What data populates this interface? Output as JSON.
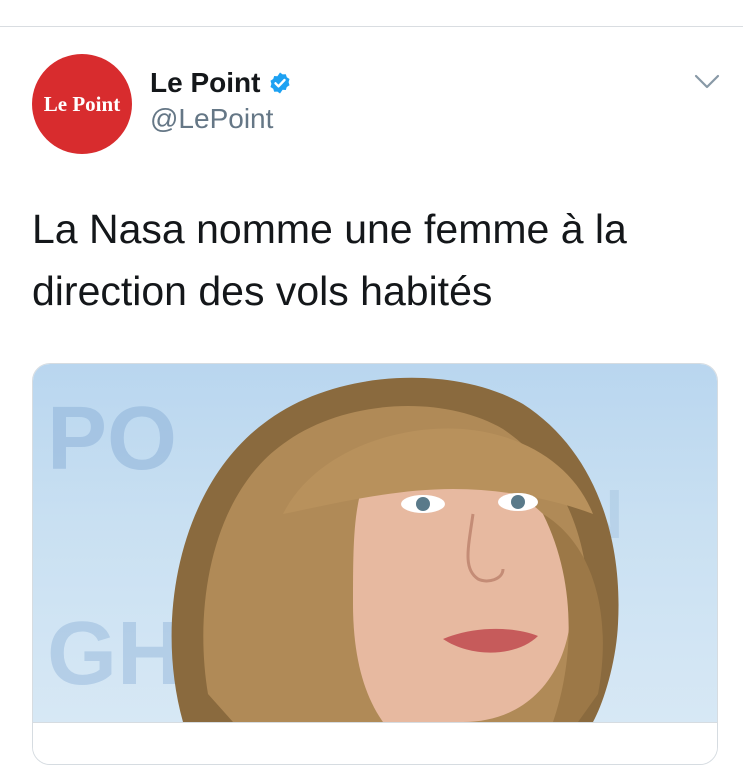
{
  "account": {
    "avatar_text": "Le Point",
    "name": "Le Point",
    "handle": "@LePoint",
    "verified": true
  },
  "tweet": {
    "line1": "La Nasa nomme une femme à la",
    "line2": "direction des vols habités"
  },
  "card": {
    "image_bg_text_1": "PO",
    "image_bg_text_2": "GH",
    "image_bg_text_3": "N"
  },
  "icons": {
    "verified": "verified-badge-icon",
    "more": "chevron-down-icon"
  },
  "colors": {
    "brand_red": "#d82c2e",
    "verified_blue": "#1da1f2",
    "text_primary": "#14171a",
    "text_secondary": "#657786"
  }
}
